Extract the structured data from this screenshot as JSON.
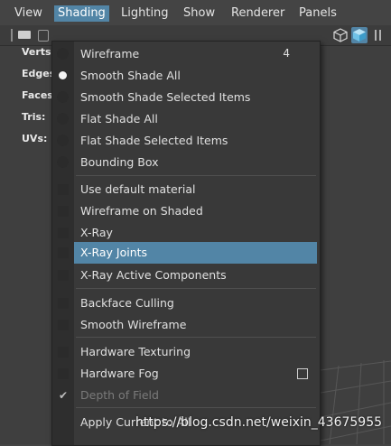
{
  "menubar": {
    "items": [
      "View",
      "Shading",
      "Lighting",
      "Show",
      "Renderer",
      "Panels"
    ],
    "active": "Shading"
  },
  "hud": {
    "labels": [
      "Verts:",
      "Edges:",
      "Faces:",
      "Tris:",
      "UVs:"
    ]
  },
  "menu": {
    "items": [
      {
        "label": "Wireframe",
        "shortcut": "4",
        "kind": "radio",
        "checked": false
      },
      {
        "label": "Smooth Shade All",
        "kind": "radio",
        "checked": true
      },
      {
        "label": "Smooth Shade Selected Items",
        "kind": "radio",
        "checked": false
      },
      {
        "label": "Flat Shade All",
        "kind": "radio",
        "checked": false
      },
      {
        "label": "Flat Shade Selected Items",
        "kind": "radio",
        "checked": false
      },
      {
        "label": "Bounding Box",
        "kind": "radio",
        "checked": false
      },
      {
        "label": "Use default material",
        "kind": "checkbox",
        "checked": false
      },
      {
        "label": "Wireframe on Shaded",
        "kind": "checkbox",
        "checked": false
      },
      {
        "label": "X-Ray",
        "kind": "checkbox",
        "checked": false
      },
      {
        "label": "X-Ray Joints",
        "kind": "checkbox",
        "checked": false,
        "highlighted": true
      },
      {
        "label": "X-Ray Active Components",
        "kind": "checkbox",
        "checked": false
      },
      {
        "label": "Backface Culling",
        "kind": "checkbox",
        "checked": false
      },
      {
        "label": "Smooth Wireframe",
        "kind": "checkbox",
        "checked": false
      },
      {
        "label": "Hardware Texturing",
        "kind": "checkbox",
        "checked": false
      },
      {
        "label": "Hardware Fog",
        "kind": "checkbox",
        "checked": false,
        "has_options": true
      },
      {
        "label": "Depth of Field",
        "kind": "checkbox",
        "checked": true,
        "disabled": true
      },
      {
        "label": "Apply Current to All",
        "kind": "command"
      }
    ]
  },
  "watermark": "https://blog.csdn.net/weixin_43675955",
  "colors": {
    "accent": "#5285a6",
    "menu_bg": "#393939",
    "gutter_bg": "#2e2e2e",
    "app_bg": "#444444"
  }
}
